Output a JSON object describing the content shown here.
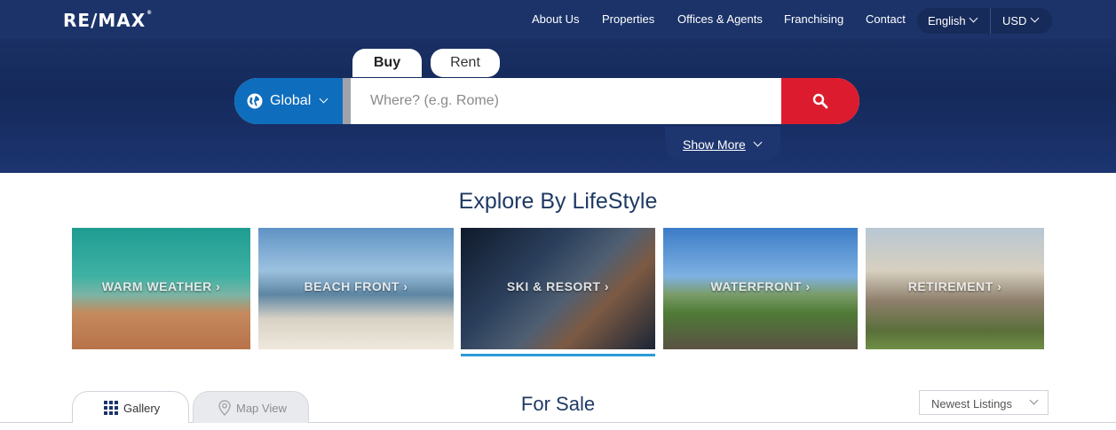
{
  "brand": {
    "logo": "RE/MAX",
    "logo_mark": "®"
  },
  "nav": {
    "items": [
      "About Us",
      "Properties",
      "Offices & Agents",
      "Franchising",
      "Contact"
    ],
    "language": "English",
    "currency": "USD"
  },
  "search": {
    "tabs": {
      "buy": "Buy",
      "rent": "Rent"
    },
    "region": "Global",
    "placeholder": "Where? (e.g. Rome)",
    "show_more": "Show More"
  },
  "explore": {
    "title": "Explore By LifeStyle",
    "cards": [
      "WARM WEATHER",
      "BEACH FRONT",
      "SKI & RESORT",
      "WATERFRONT",
      "RETIREMENT"
    ],
    "active_card": "SKI & RESORT"
  },
  "listings": {
    "view_tabs": {
      "gallery": "Gallery",
      "map": "Map View"
    },
    "title": "For Sale",
    "sort": "Newest Listings"
  },
  "colors": {
    "nav_bg": "#1b3369",
    "region_blue": "#0f6dbd",
    "search_red": "#dc1c2e",
    "heading_navy": "#1f3a64",
    "active_underline": "#2a9bd8"
  }
}
